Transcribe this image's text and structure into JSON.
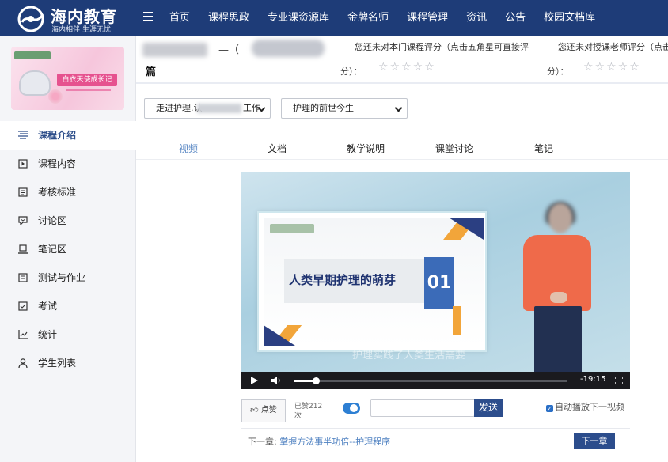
{
  "app": {
    "logo_title": "海内教育",
    "logo_subtitle": "海内相伴 生涯无忧"
  },
  "nav": {
    "items": [
      "首页",
      "课程思政",
      "专业课资源库",
      "金牌名师",
      "课程管理",
      "资讯",
      "公告",
      "校园文档库"
    ]
  },
  "sidebar": {
    "banner_text": "白衣天使成长记",
    "items": [
      {
        "label": "课程介绍",
        "icon": "list-icon",
        "active": true
      },
      {
        "label": "课程内容",
        "icon": "video-icon",
        "active": false
      },
      {
        "label": "考核标准",
        "icon": "clipboard-icon",
        "active": false
      },
      {
        "label": "讨论区",
        "icon": "chat-icon",
        "active": false
      },
      {
        "label": "笔记区",
        "icon": "laptop-icon",
        "active": false
      },
      {
        "label": "测试与作业",
        "icon": "document-icon",
        "active": false
      },
      {
        "label": "考试",
        "icon": "exam-icon",
        "active": false
      },
      {
        "label": "统计",
        "icon": "chart-icon",
        "active": false
      },
      {
        "label": "学生列表",
        "icon": "user-icon",
        "active": false
      }
    ]
  },
  "course_header": {
    "title_middle": "—（",
    "title_tail": "篇",
    "course_rating_prompt": "您还未对本门课程评分（点击五角星可直接评",
    "teacher_rating_prompt": "您还未对授课老师评分（点击五",
    "score_label": "分）：",
    "stars": "☆☆☆☆☆"
  },
  "selects": {
    "chapter": "走进护理.认",
    "chapter_suffix": "工作",
    "section": "护理的前世今生"
  },
  "tabs": [
    {
      "label": "视频",
      "active": true
    },
    {
      "label": "文档",
      "active": false
    },
    {
      "label": "教学说明",
      "active": false
    },
    {
      "label": "课堂讨论",
      "active": false
    },
    {
      "label": "笔记",
      "active": false
    }
  ],
  "video": {
    "slide_title": "人类早期护理的萌芽",
    "slide_number": "01",
    "subtitle": "护理实践了人类生活需要",
    "time_remaining": "-19:15",
    "progress_fraction": 0.08
  },
  "interaction": {
    "like_label": "点赞",
    "liked_count": "已赞212次",
    "comment_placeholder": "",
    "send_label": "发送",
    "autoplay_label": "自动播放下一视频",
    "autoplay_checked": true
  },
  "footer": {
    "next_prefix": "下一章:",
    "next_title": "掌握方法事半功倍--护理程序",
    "next_button": "下一章"
  }
}
